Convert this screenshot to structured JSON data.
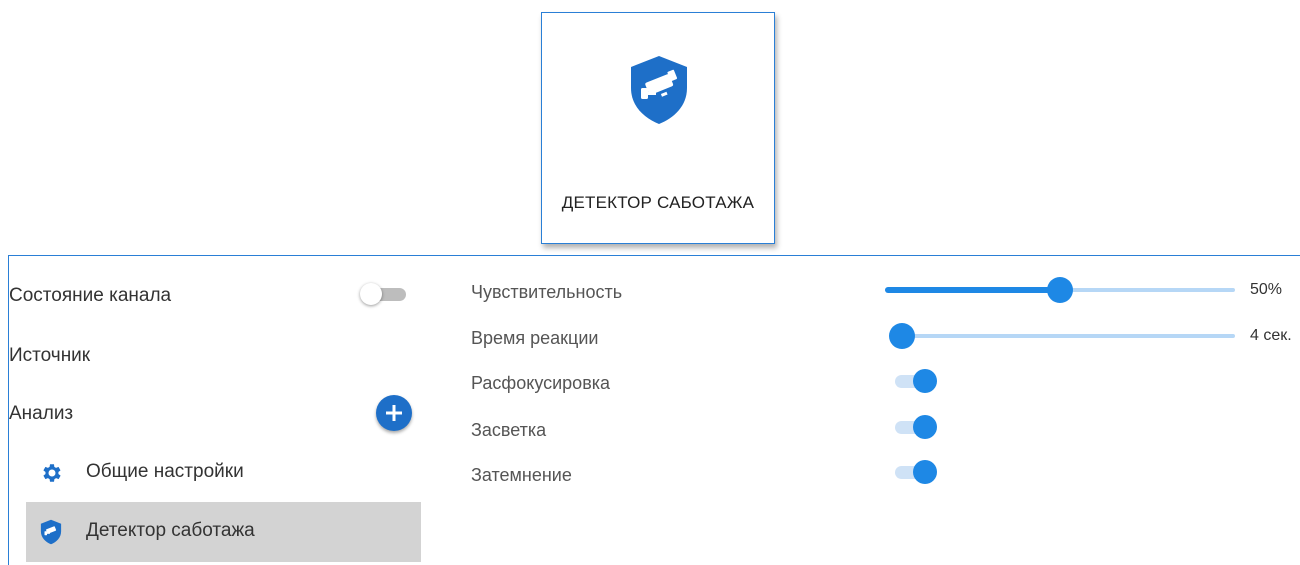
{
  "card": {
    "title": "ДЕТЕКТОР САБОТАЖА",
    "icon": "shield-camera-icon"
  },
  "sidebar": {
    "channel_state": {
      "label": "Состояние канала",
      "enabled": false
    },
    "source": {
      "label": "Источник"
    },
    "analysis": {
      "label": "Анализ",
      "add_icon": "plus-icon"
    },
    "items": [
      {
        "label": "Общие настройки",
        "icon": "gear-icon",
        "selected": false
      },
      {
        "label": "Детектор саботажа",
        "icon": "shield-camera-icon",
        "selected": true
      }
    ]
  },
  "settings": {
    "sensitivity": {
      "label": "Чувствительность",
      "value": 50,
      "value_text": "50%"
    },
    "reaction_time": {
      "label": "Время реакции",
      "value_text": "4 сек.",
      "fraction": 0
    },
    "defocus": {
      "label": "Расфокусировка",
      "enabled": true
    },
    "flare": {
      "label": "Засветка",
      "enabled": true
    },
    "darkening": {
      "label": "Затемнение",
      "enabled": true
    }
  },
  "colors": {
    "accent": "#1e88e5",
    "accent_dark": "#1e6fc8",
    "selected_bg": "#d3d3d3",
    "border": "#2a7fd6"
  }
}
